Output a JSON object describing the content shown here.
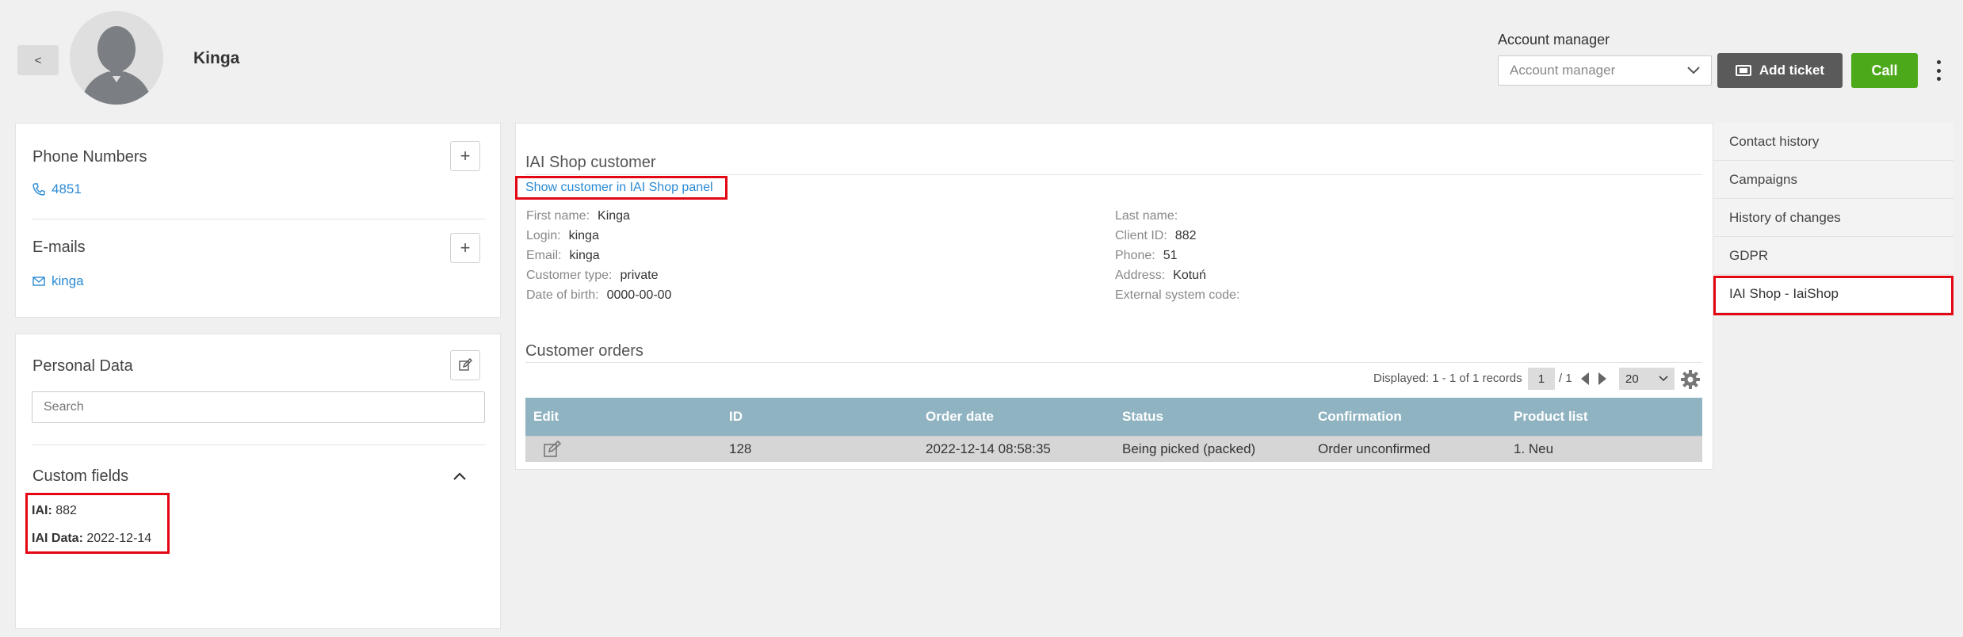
{
  "header": {
    "back_label": "<",
    "customer_name": "Kinga",
    "account_manager_label": "Account manager",
    "account_manager_placeholder": "Account manager",
    "add_ticket_label": "Add ticket",
    "call_label": "Call"
  },
  "left": {
    "phone_title": "Phone Numbers",
    "phone_value": "4851",
    "emails_title": "E-mails",
    "email_value": "kinga",
    "personal_title": "Personal Data",
    "search_placeholder": "Search",
    "custom_title": "Custom fields",
    "custom_fields": [
      {
        "label": "IAI:",
        "value": "882"
      },
      {
        "label": "IAI Data:",
        "value": "2022-12-14"
      }
    ]
  },
  "main": {
    "shop_title": "IAI Shop customer",
    "show_link": "Show customer in IAI Shop panel",
    "left_info": [
      {
        "label": "First name:",
        "value": "Kinga"
      },
      {
        "label": "Login:",
        "value": "kinga"
      },
      {
        "label": "Email:",
        "value": "kinga"
      },
      {
        "label": "Customer type:",
        "value": "private"
      },
      {
        "label": "Date of birth:",
        "value": "0000-00-00"
      }
    ],
    "right_info": [
      {
        "label": "Last name:",
        "value": ""
      },
      {
        "label": "Client ID:",
        "value": "882"
      },
      {
        "label": "Phone:",
        "value": "51"
      },
      {
        "label": "Address:",
        "value": "Kotuń"
      },
      {
        "label": "External system code:",
        "value": ""
      }
    ],
    "orders_title": "Customer orders",
    "pager": {
      "displayed": "Displayed: 1 - 1 of 1 records",
      "page": "1",
      "total_pages": "/ 1",
      "per_page": "20"
    },
    "columns": [
      "Edit",
      "ID",
      "Order date",
      "Status",
      "Confirmation",
      "Product list"
    ],
    "rows": [
      {
        "id": "128",
        "date": "2022-12-14 08:58:35",
        "status": "Being picked (packed)",
        "confirmation": "Order unconfirmed",
        "products": "1. Neu"
      }
    ]
  },
  "side_menu": [
    "Contact history",
    "Campaigns",
    "History of changes",
    "GDPR",
    "IAI Shop - IaiShop"
  ],
  "colors": {
    "accent_link": "#2a8ad4",
    "call_green": "#4caa1a",
    "ticket_gray": "#5a5a5a",
    "table_header": "#8fb3c1",
    "highlight_red": "#e30613"
  }
}
